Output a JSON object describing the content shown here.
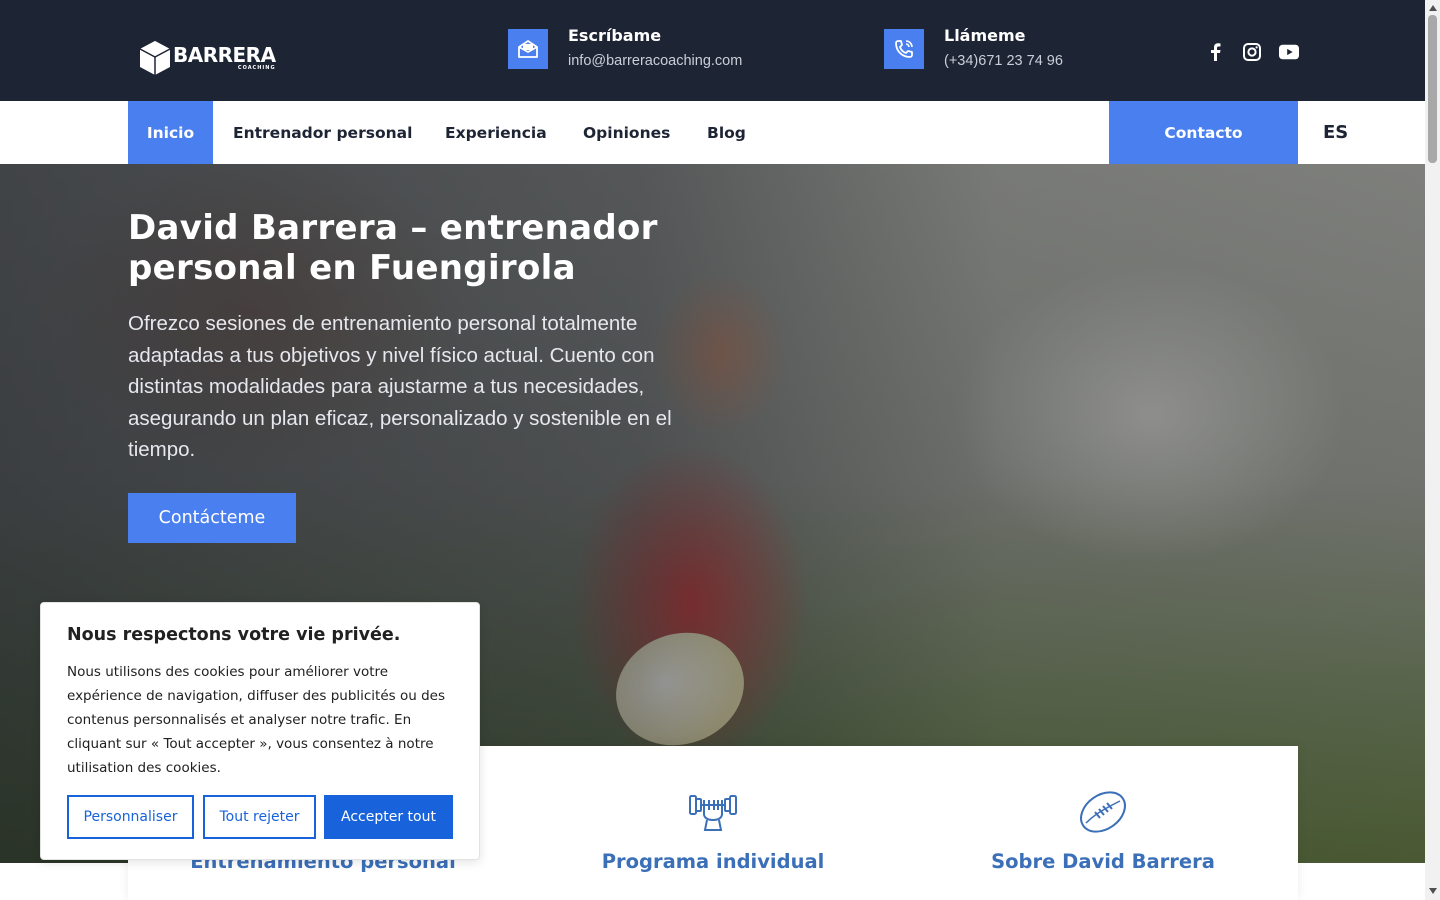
{
  "header": {
    "logo_name": "BARRERA",
    "logo_sub": "COACHING",
    "email_title": "Escríbame",
    "email_value": "info@barreracoaching.com",
    "phone_title": "Llámeme",
    "phone_value": "(+34)671 23 74 96",
    "socials": [
      "facebook-icon",
      "instagram-icon",
      "youtube-icon"
    ]
  },
  "nav": {
    "items": [
      {
        "label": "Inicio",
        "active": true
      },
      {
        "label": "Entrenador personal"
      },
      {
        "label": "Experiencia"
      },
      {
        "label": "Opiniones"
      },
      {
        "label": "Blog"
      }
    ],
    "contact_label": "Contacto",
    "lang_label": "ES"
  },
  "hero": {
    "title": "David Barrera – entrenador personal en Fuengirola",
    "text": "Ofrezco sesiones de entrenamiento personal totalmente adaptadas a tus objetivos y nivel físico actual. Cuento con distintas modalidades para ajustarme a tus necesidades, asegurando un plan eficaz, personalizado y sostenible en el tiempo.",
    "button_label": "Contácteme"
  },
  "services": [
    {
      "title": "Entrenamiento personal",
      "icon": "trainer-icon"
    },
    {
      "title": "Programa individual",
      "icon": "dumbbell-hand-icon"
    },
    {
      "title": "Sobre David Barrera",
      "icon": "rugby-ball-icon"
    }
  ],
  "cookie": {
    "title": "Nous respectons votre vie privée.",
    "text": "Nous utilisons des cookies pour améliorer votre expérience de navigation, diffuser des publicités ou des contenus personnalisés et analyser notre trafic. En cliquant sur « Tout accepter », vous consentez à notre utilisation des cookies.",
    "customize_label": "Personnaliser",
    "reject_label": "Tout rejeter",
    "accept_label": "Accepter tout"
  },
  "colors": {
    "topbar": "#1d2434",
    "accent": "#4a7ff0",
    "service_title": "#3b6fb8",
    "cookie_button": "#1863dc"
  }
}
